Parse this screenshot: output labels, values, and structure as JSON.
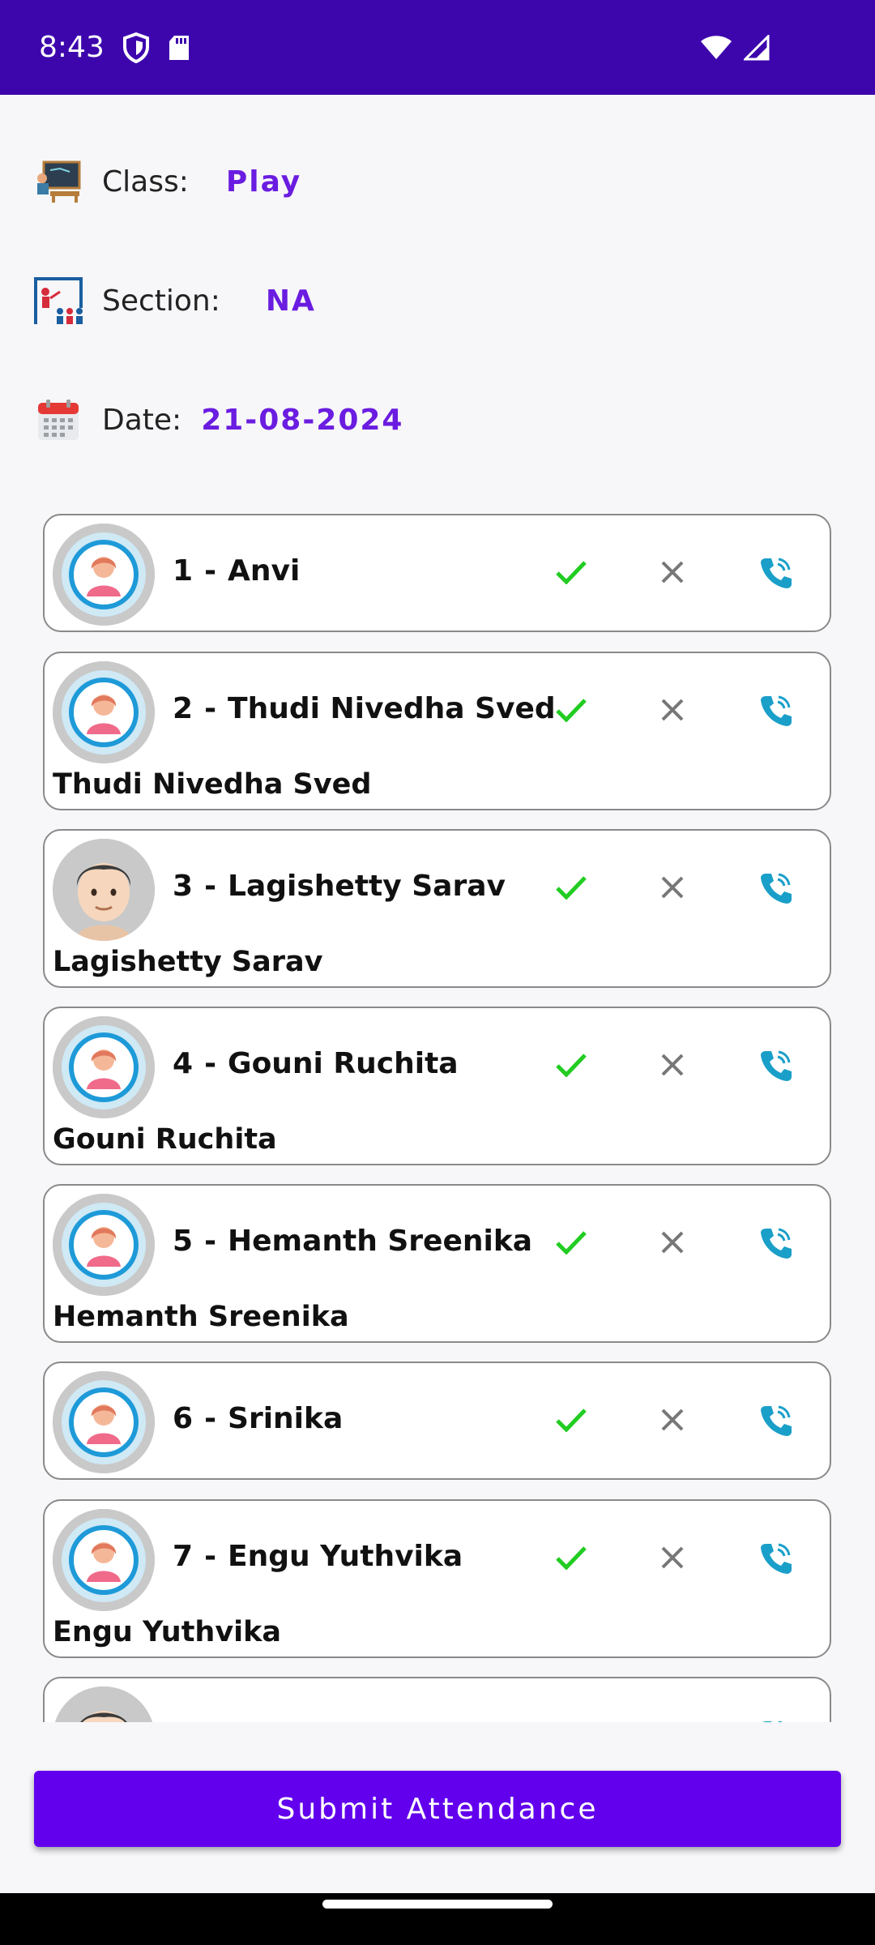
{
  "status_bar": {
    "time": "8:43",
    "icons": [
      "shield-icon",
      "sd-card-icon",
      "wifi-icon",
      "signal-icon"
    ]
  },
  "info": {
    "class_label": "Class:",
    "class_value": "Play",
    "section_label": "Section:",
    "section_value": "NA",
    "date_label": "Date:",
    "date_value": "21-08-2024"
  },
  "students": [
    {
      "number": "1",
      "name": "Anvi",
      "subtitle": "",
      "avatar": "girl-avatar"
    },
    {
      "number": "2",
      "name": "Thudi Nivedha Sved",
      "subtitle": "Thudi Nivedha Sved",
      "avatar": "girl-avatar"
    },
    {
      "number": "3",
      "name": "Lagishetty Sarav",
      "subtitle": "Lagishetty Sarav",
      "avatar": "boy-avatar"
    },
    {
      "number": "4",
      "name": "Gouni Ruchita",
      "subtitle": "Gouni Ruchita",
      "avatar": "girl-avatar"
    },
    {
      "number": "5",
      "name": "Hemanth Sreenika",
      "subtitle": "Hemanth Sreenika",
      "avatar": "girl-avatar"
    },
    {
      "number": "6",
      "name": "Srinika",
      "subtitle": "",
      "avatar": "girl-avatar"
    },
    {
      "number": "7",
      "name": "Engu Yuthvika",
      "subtitle": "Engu Yuthvika",
      "avatar": "girl-avatar"
    }
  ],
  "separator": "-",
  "submit_label": "Submit Attendance",
  "colors": {
    "status_bar": "#3d06ad",
    "accent": "#6200ee",
    "value_text": "#6a1ce0",
    "present": "#22cc22",
    "absent": "#777777",
    "call": "#1a9fc9"
  }
}
